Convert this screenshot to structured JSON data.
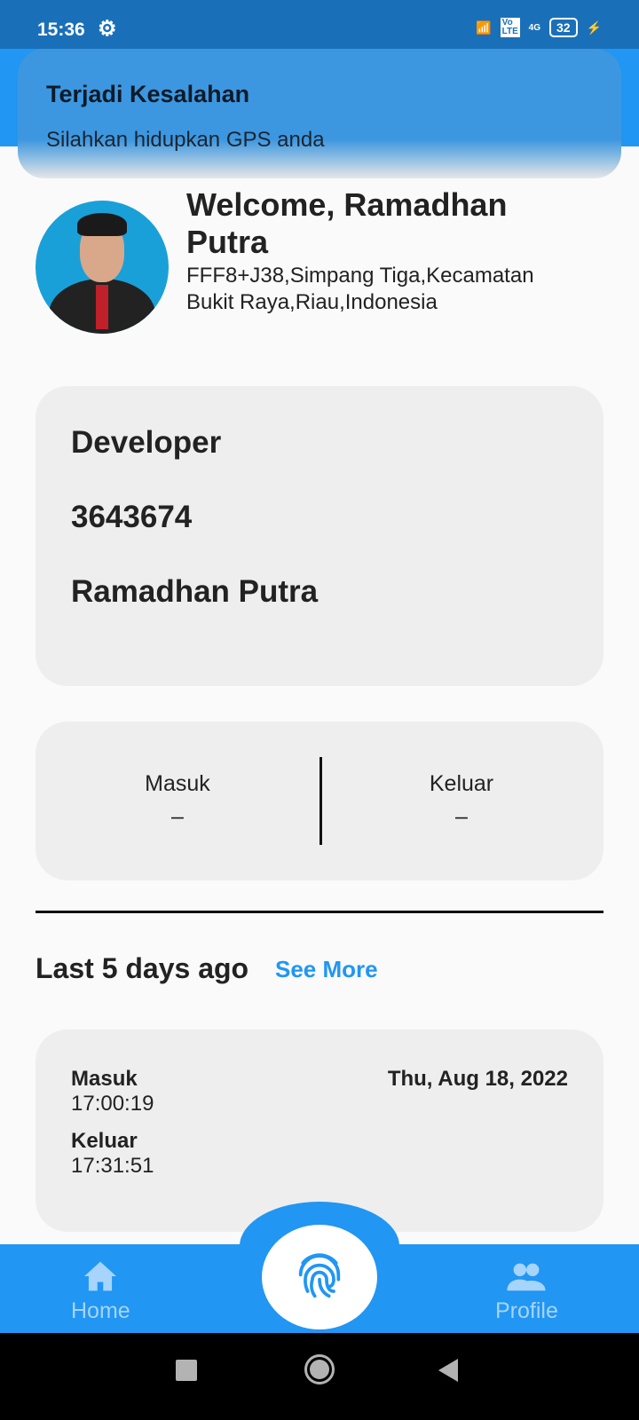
{
  "status_bar": {
    "time": "15:36",
    "battery": "32",
    "network": "4G",
    "volte": "Vo LTE"
  },
  "toast": {
    "title": "Terjadi Kesalahan",
    "message": "Silahkan hidupkan GPS anda"
  },
  "header": {
    "welcome": "Welcome, Ramadhan Putra",
    "address": "FFF8+J38,Simpang Tiga,Kecamatan Bukit Raya,Riau,Indonesia"
  },
  "info": {
    "position": "Developer",
    "id": "3643674",
    "name": "Ramadhan Putra"
  },
  "attendance": {
    "in_label": "Masuk",
    "in_value": "–",
    "out_label": "Keluar",
    "out_value": "–"
  },
  "history": {
    "title": "Last 5 days ago",
    "see_more": "See More",
    "items": [
      {
        "in_label": "Masuk",
        "in_time": "17:00:19",
        "out_label": "Keluar",
        "out_time": "17:31:51",
        "date": "Thu, Aug 18, 2022"
      }
    ]
  },
  "nav": {
    "home": "Home",
    "profile": "Profile"
  },
  "colors": {
    "primary": "#2196f3",
    "status": "#1a70b8"
  }
}
